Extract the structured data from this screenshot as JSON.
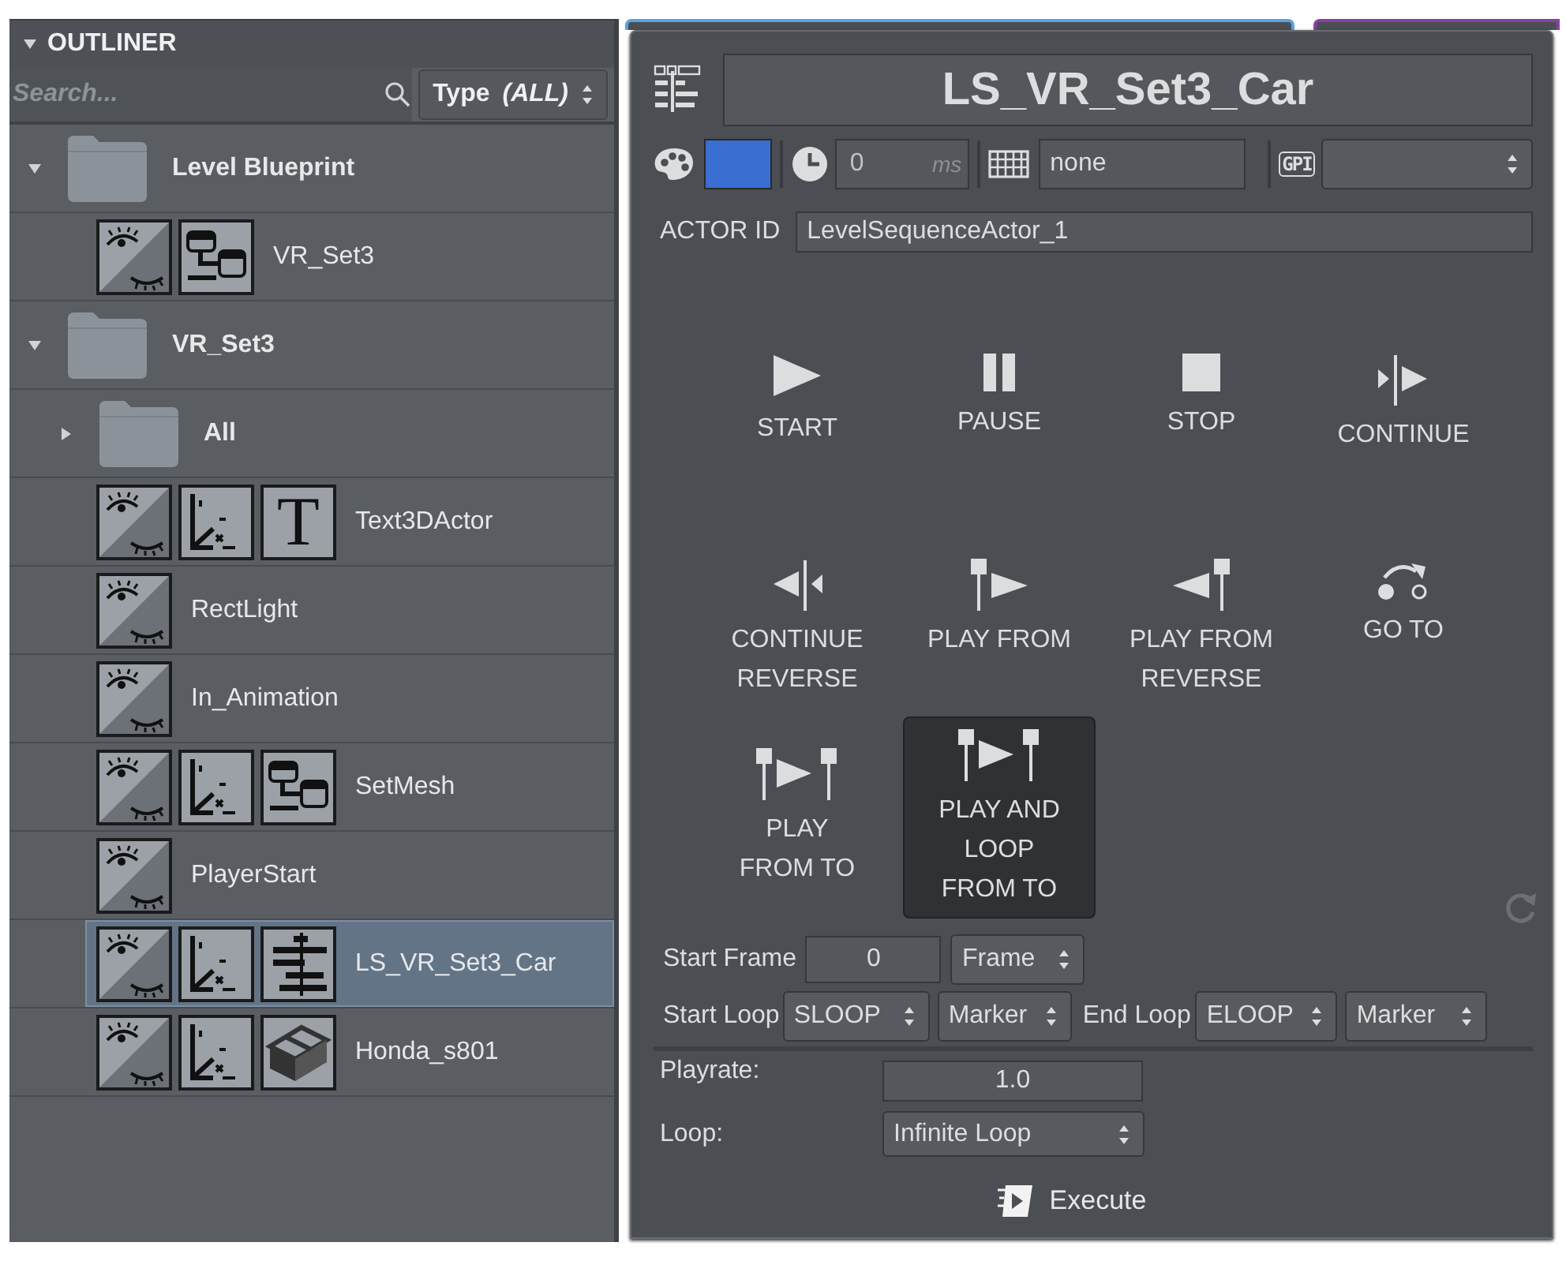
{
  "outliner": {
    "title": "OUTLINER",
    "expanded": true,
    "search": {
      "placeholder": "Search..."
    },
    "type_filter": {
      "label": "Type",
      "value": "(ALL)"
    },
    "tree": [
      {
        "kind": "folder",
        "label": "Level Blueprint",
        "expanded": true,
        "selected": false,
        "children": [
          {
            "kind": "actor",
            "label": "VR_Set3",
            "selected": false,
            "icons": [
              {
                "kind": "visibility"
              },
              {
                "kind": "graph"
              }
            ]
          }
        ]
      },
      {
        "kind": "folder",
        "label": "VR_Set3",
        "expanded": true,
        "selected": false,
        "children": [
          {
            "kind": "folder",
            "label": "All",
            "expanded": false,
            "selected": false
          },
          {
            "kind": "actor",
            "label": "Text3DActor",
            "selected": false,
            "icons": [
              {
                "kind": "visibility"
              },
              {
                "kind": "axes"
              },
              {
                "kind": "text",
                "glyph": "T"
              }
            ]
          },
          {
            "kind": "actor",
            "label": "RectLight",
            "selected": false,
            "icons": [
              {
                "kind": "visibility"
              }
            ]
          },
          {
            "kind": "actor",
            "label": "In_Animation",
            "selected": false,
            "icons": [
              {
                "kind": "visibility"
              }
            ]
          },
          {
            "kind": "actor",
            "label": "SetMesh",
            "selected": false,
            "icons": [
              {
                "kind": "visibility"
              },
              {
                "kind": "axes"
              },
              {
                "kind": "graph"
              }
            ]
          },
          {
            "kind": "actor",
            "label": "PlayerStart",
            "selected": false,
            "icons": [
              {
                "kind": "visibility"
              }
            ]
          },
          {
            "kind": "actor",
            "label": "LS_VR_Set3_Car",
            "selected": true,
            "icons": [
              {
                "kind": "visibility"
              },
              {
                "kind": "axes"
              },
              {
                "kind": "sequence"
              }
            ]
          },
          {
            "kind": "actor",
            "label": "Honda_s801",
            "selected": false,
            "icons": [
              {
                "kind": "visibility"
              },
              {
                "kind": "axes"
              },
              {
                "kind": "mesh"
              }
            ]
          }
        ]
      }
    ]
  },
  "sequence_panel": {
    "title": "LS_VR_Set3_Car",
    "color": "#3a6ed0",
    "delay": {
      "value": "0",
      "unit": "ms"
    },
    "hotkey": "none",
    "gpi_label": "GPI",
    "actor_id": {
      "label": "ACTOR ID",
      "value": "LevelSequenceActor_1"
    },
    "actions": [
      {
        "kind": "start",
        "lines": [
          "START"
        ],
        "selected": false
      },
      {
        "kind": "pause",
        "lines": [
          "PAUSE"
        ],
        "selected": false
      },
      {
        "kind": "stop",
        "lines": [
          "STOP"
        ],
        "selected": false
      },
      {
        "kind": "continue",
        "lines": [
          "CONTINUE"
        ],
        "selected": false
      },
      {
        "kind": "continue_reverse",
        "lines": [
          "CONTINUE",
          "REVERSE"
        ],
        "selected": false
      },
      {
        "kind": "play_from",
        "lines": [
          "PLAY FROM"
        ],
        "selected": false
      },
      {
        "kind": "play_from_reverse",
        "lines": [
          "PLAY FROM",
          "REVERSE"
        ],
        "selected": false
      },
      {
        "kind": "go_to",
        "lines": [
          "GO TO"
        ],
        "selected": false
      },
      {
        "kind": "play_from_to",
        "lines": [
          "PLAY",
          "FROM TO"
        ],
        "selected": false
      },
      {
        "kind": "play_loop_from_to",
        "lines": [
          "PLAY AND",
          "LOOP",
          "FROM TO"
        ],
        "selected": true
      }
    ],
    "start_frame": {
      "label": "Start Frame",
      "value": "0",
      "unit": "Frame"
    },
    "start_loop": {
      "label": "Start Loop",
      "value": "SLOOP",
      "unit": "Marker"
    },
    "end_loop": {
      "label": "End Loop",
      "value": "ELOOP",
      "unit": "Marker"
    },
    "playrate": {
      "label": "Playrate:",
      "value": "1.0"
    },
    "loop": {
      "label": "Loop:",
      "value": "Infinite Loop"
    },
    "execute": "Execute"
  }
}
